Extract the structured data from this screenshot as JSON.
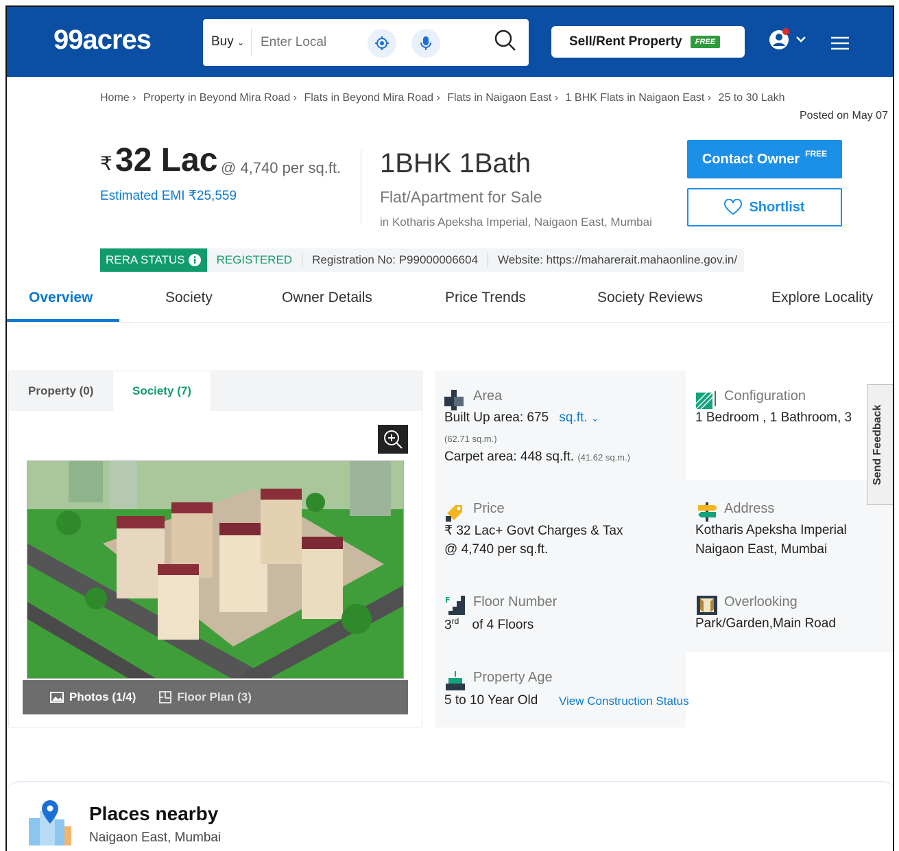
{
  "header": {
    "logo": "99acres",
    "buy_label": "Buy",
    "search_placeholder": "Enter Local",
    "sell_label": "Sell/Rent Property",
    "sell_badge": "FREE"
  },
  "breadcrumb": [
    "Home ›",
    "Property in Beyond Mira Road ›",
    "Flats in Beyond Mira Road ›",
    "Flats in Naigaon East ›",
    "1 BHK Flats in Naigaon East ›",
    "25 to 30 Lakh"
  ],
  "posted": "Posted on May 07",
  "listing": {
    "rupee": "₹",
    "price": "32 Lac",
    "per_sqft": "@ 4,740 per sq.ft.",
    "emi": "Estimated EMI ₹25,559",
    "bhk": "1BHK 1Bath",
    "type": "Flat/Apartment for Sale",
    "location": "in Kotharis Apeksha Imperial, Naigaon East, Mumbai",
    "contact_label": "Contact Owner",
    "contact_badge": "FREE",
    "shortlist_label": "Shortlist"
  },
  "rera": {
    "status_label": "RERA STATUS",
    "registered": "REGISTERED",
    "registration_no": "Registration No: P99000006604",
    "website": "Website: https://maharerait.mahaonline.gov.in/"
  },
  "tabs": [
    "Overview",
    "Society",
    "Owner Details",
    "Price Trends",
    "Society Reviews",
    "Explore Locality"
  ],
  "gallery": {
    "tabs": [
      "Property (0)",
      "Society (7)"
    ],
    "photos_label": "Photos (1/4)",
    "floorplan_label": "Floor Plan (3)"
  },
  "details": {
    "area_label": "Area",
    "built_up": "Built Up area: 675",
    "built_up_unit": "sq.ft.",
    "built_up_sqm": "(62.71 sq.m.)",
    "carpet": "Carpet area: 448 sq.ft.",
    "carpet_sqm": "(41.62 sq.m.)",
    "config_label": "Configuration",
    "config_value": "1 Bedroom , 1 Bathroom, 3",
    "price_label": "Price",
    "price_line1": "₹ 32 Lac+ Govt Charges & Tax",
    "price_line2": "@ 4,740 per sq.ft.",
    "address_label": "Address",
    "address_line1": "Kotharis Apeksha Imperial",
    "address_line2": "Naigaon East, Mumbai",
    "floor_label": "Floor Number",
    "floor_num": "3",
    "floor_sup": "rd",
    "floor_rest": "of 4 Floors",
    "overlooking_label": "Overlooking",
    "overlooking_value": "Park/Garden,Main Road",
    "age_label": "Property Age",
    "age_value": "5 to 10 Year Old",
    "construction_link": "View Construction Status"
  },
  "feedback": "Send Feedback",
  "places": {
    "title": "Places nearby",
    "subtitle": "Naigaon East, Mumbai"
  },
  "colors": {
    "brand_blue": "#0a4fa3",
    "link_blue": "#0a78d1",
    "rera_green": "#119b6c",
    "free_green": "#2f9c3d"
  }
}
